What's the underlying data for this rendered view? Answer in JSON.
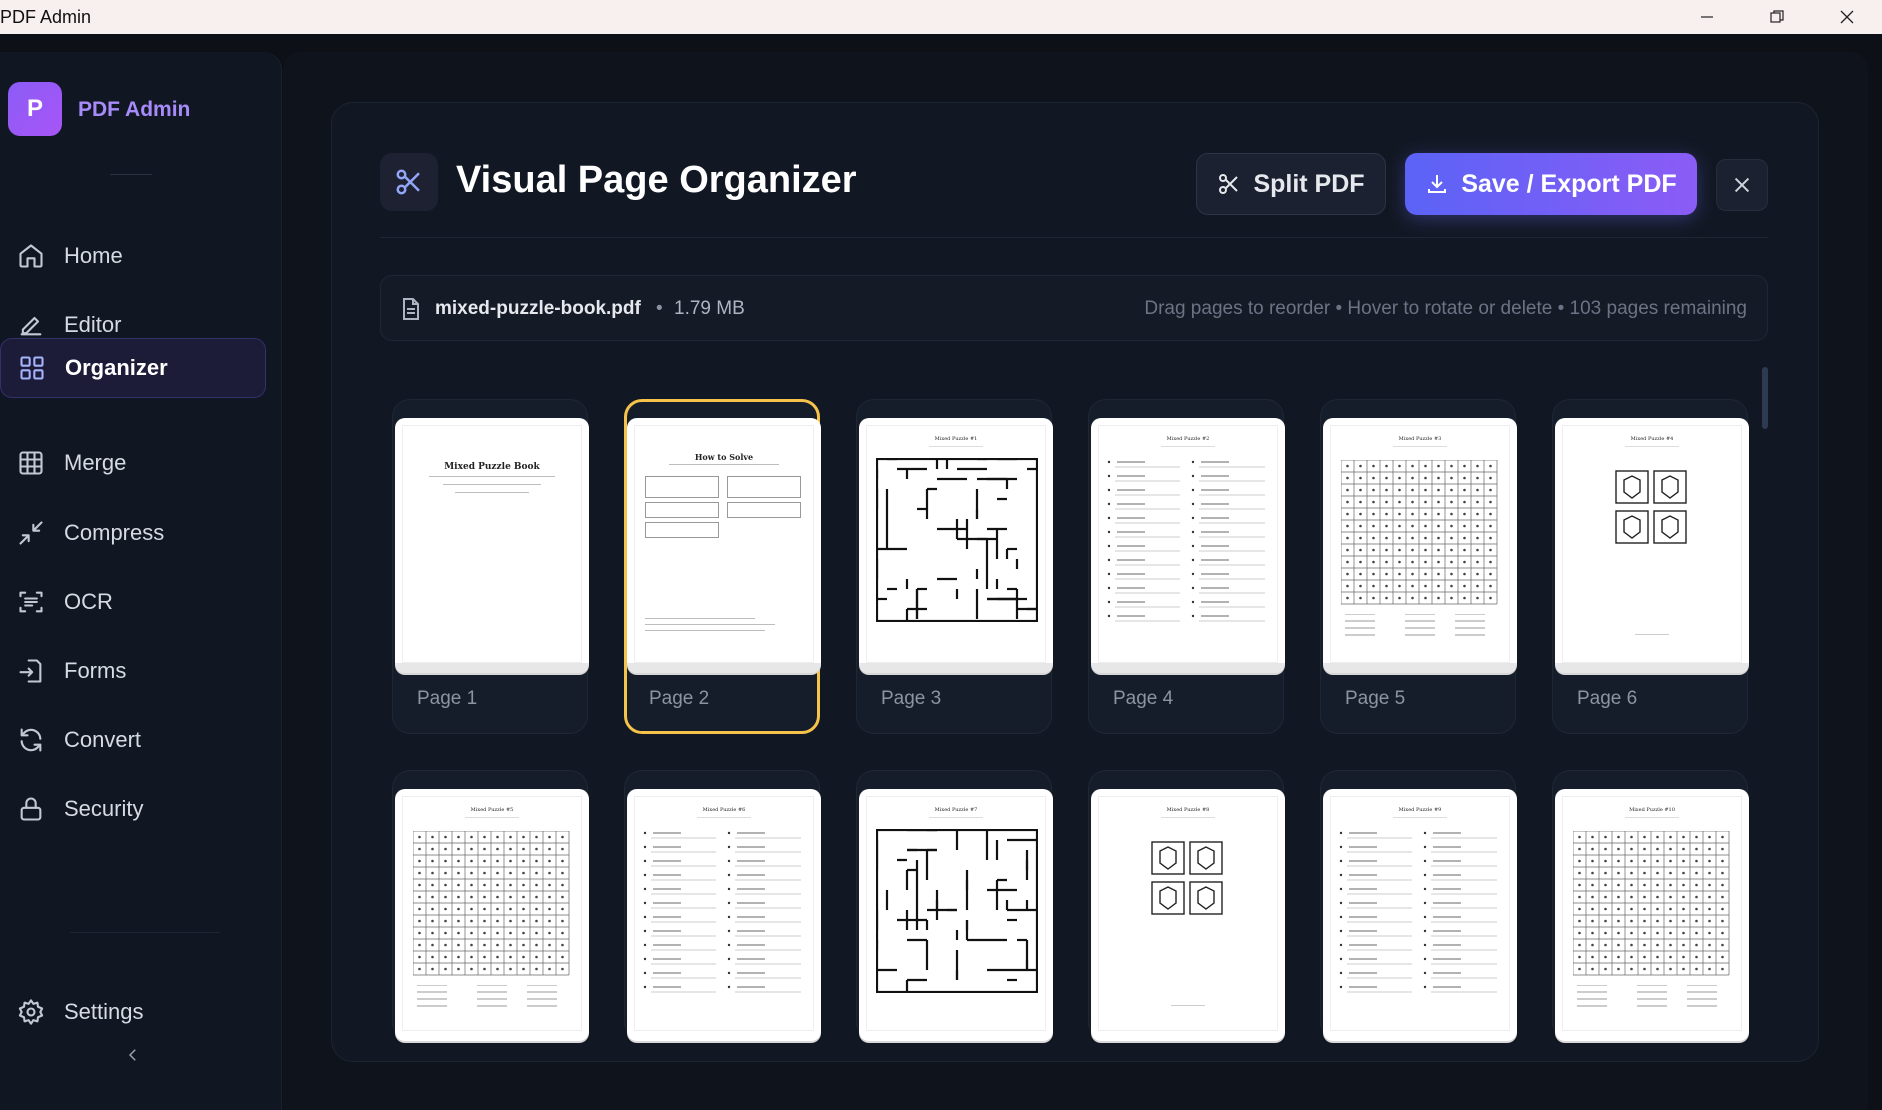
{
  "window": {
    "title": "PDF Admin"
  },
  "sidebar": {
    "logo_letter": "P",
    "brand": "PDF Admin",
    "items": [
      {
        "label": "Home",
        "icon": "home-icon"
      },
      {
        "label": "Editor",
        "icon": "pencil-icon"
      },
      {
        "label": "Organizer",
        "icon": "grid-icon",
        "active": true
      },
      {
        "label": "Merge",
        "icon": "table-grid-icon"
      },
      {
        "label": "Compress",
        "icon": "compress-arrows-icon"
      },
      {
        "label": "OCR",
        "icon": "scan-text-icon"
      },
      {
        "label": "Forms",
        "icon": "form-enter-icon"
      },
      {
        "label": "Convert",
        "icon": "refresh-icon"
      },
      {
        "label": "Security",
        "icon": "lock-icon"
      }
    ],
    "settings": {
      "label": "Settings",
      "icon": "gear-icon"
    },
    "collapse_icon": "chevron-left-icon"
  },
  "header": {
    "icon": "scissors-icon",
    "title": "Visual Page Organizer",
    "split_label": "Split PDF",
    "save_label": "Save / Export PDF",
    "close_icon": "close-icon"
  },
  "file": {
    "name": "mixed-puzzle-book.pdf",
    "separator": "•",
    "size": "1.79 MB",
    "hint": "Drag pages to reorder • Hover to rotate or delete • 103 pages remaining"
  },
  "pages": [
    {
      "label": "Page 1",
      "kind": "cover",
      "title": "Mixed Puzzle Book"
    },
    {
      "label": "Page 2",
      "kind": "instructions",
      "title": "How to Solve",
      "selected": true
    },
    {
      "label": "Page 3",
      "kind": "maze",
      "title": "Mixed Puzzle #1"
    },
    {
      "label": "Page 4",
      "kind": "math",
      "title": "Mixed Puzzle #2"
    },
    {
      "label": "Page 5",
      "kind": "wordsearch",
      "title": "Mixed Puzzle #3"
    },
    {
      "label": "Page 6",
      "kind": "logic",
      "title": "Mixed Puzzle #4"
    },
    {
      "label": "",
      "kind": "wordsearch",
      "title": "Mixed Puzzle #5"
    },
    {
      "label": "",
      "kind": "math",
      "title": "Mixed Puzzle #6"
    },
    {
      "label": "",
      "kind": "maze",
      "title": "Mixed Puzzle #7"
    },
    {
      "label": "",
      "kind": "logic",
      "title": "Mixed Puzzle #8"
    },
    {
      "label": "",
      "kind": "math",
      "title": "Mixed Puzzle #9"
    },
    {
      "label": "",
      "kind": "wordsearch",
      "title": "Mixed Puzzle #10"
    }
  ],
  "colors": {
    "accent": "#6366f1",
    "accent2": "#8b5cf6",
    "selected_border": "#f5c24a",
    "background": "#0d1117"
  }
}
